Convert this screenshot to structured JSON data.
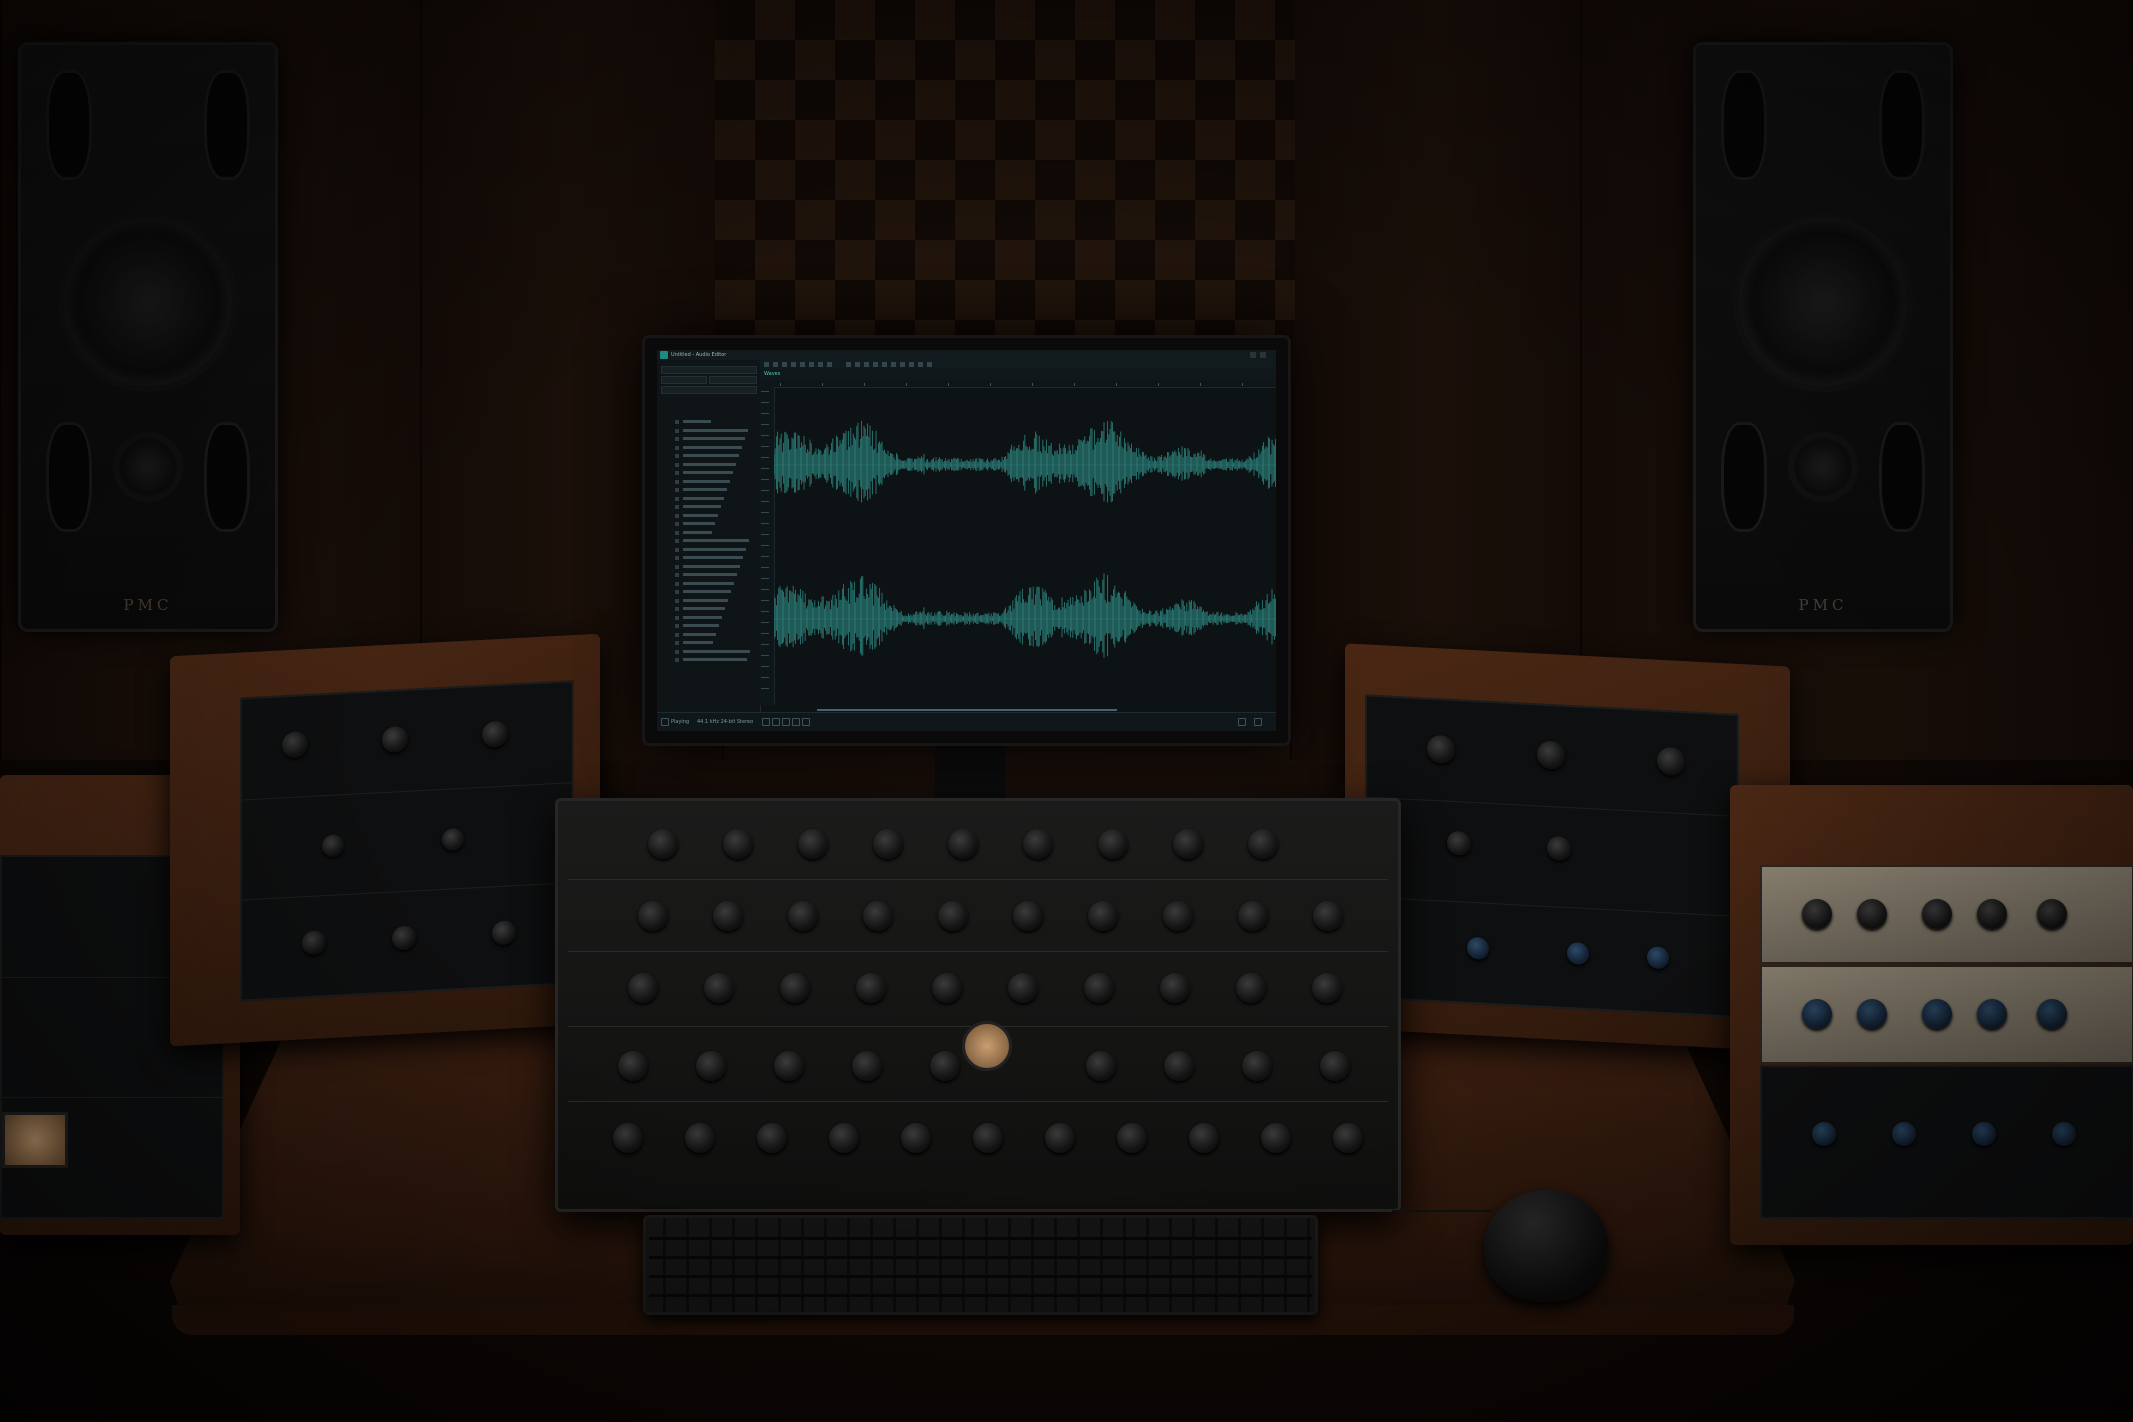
{
  "scene": {
    "left_speaker_logo": "PMC",
    "right_speaker_logo": "PMC"
  },
  "daw": {
    "window_title": "Untitled - Audio Editor",
    "editor_tab": "Waves",
    "file_rows": 29,
    "status_left": "Playing",
    "status_mid": "44.1 kHz 24-bit Stereo",
    "accent_color": "#3fd0c0",
    "waveform_color": "#2f8c86"
  },
  "colors": {
    "desk": "#3a1e10",
    "wall": "#1a0f09"
  }
}
